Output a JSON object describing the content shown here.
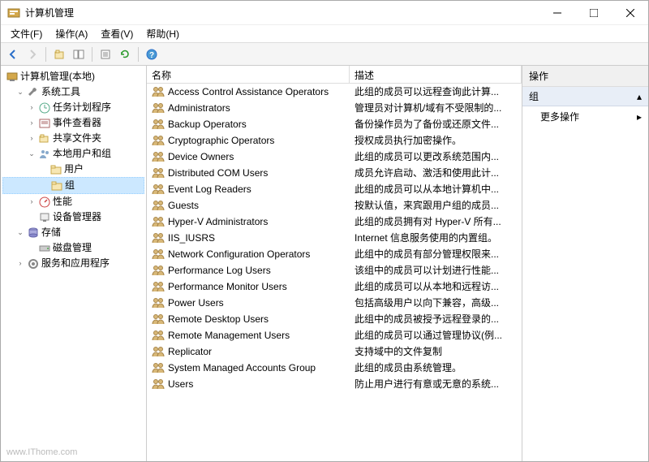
{
  "titlebar": {
    "title": "计算机管理"
  },
  "menubar": {
    "items": [
      "文件(F)",
      "操作(A)",
      "查看(V)",
      "帮助(H)"
    ]
  },
  "tree": {
    "root": "计算机管理(本地)",
    "nodes": [
      {
        "label": "系统工具",
        "depth": 1,
        "expanded": true,
        "icon": "wrench"
      },
      {
        "label": "任务计划程序",
        "depth": 2,
        "expanded": false,
        "hasChildren": true,
        "icon": "clock"
      },
      {
        "label": "事件查看器",
        "depth": 2,
        "expanded": false,
        "hasChildren": true,
        "icon": "event"
      },
      {
        "label": "共享文件夹",
        "depth": 2,
        "expanded": false,
        "hasChildren": true,
        "icon": "share"
      },
      {
        "label": "本地用户和组",
        "depth": 2,
        "expanded": true,
        "hasChildren": true,
        "icon": "users"
      },
      {
        "label": "用户",
        "depth": 3,
        "icon": "folder"
      },
      {
        "label": "组",
        "depth": 3,
        "icon": "folder",
        "selected": true
      },
      {
        "label": "性能",
        "depth": 2,
        "expanded": false,
        "hasChildren": true,
        "icon": "perf"
      },
      {
        "label": "设备管理器",
        "depth": 2,
        "icon": "device"
      },
      {
        "label": "存储",
        "depth": 1,
        "expanded": true,
        "icon": "storage"
      },
      {
        "label": "磁盘管理",
        "depth": 2,
        "icon": "disk"
      },
      {
        "label": "服务和应用程序",
        "depth": 1,
        "expanded": false,
        "hasChildren": true,
        "icon": "services"
      }
    ]
  },
  "list": {
    "columns": {
      "name": "名称",
      "desc": "描述"
    },
    "rows": [
      {
        "name": "Access Control Assistance Operators",
        "desc": "此组的成员可以远程查询此计算..."
      },
      {
        "name": "Administrators",
        "desc": "管理员对计算机/域有不受限制的..."
      },
      {
        "name": "Backup Operators",
        "desc": "备份操作员为了备份或还原文件..."
      },
      {
        "name": "Cryptographic Operators",
        "desc": "授权成员执行加密操作。"
      },
      {
        "name": "Device Owners",
        "desc": "此组的成员可以更改系统范围内..."
      },
      {
        "name": "Distributed COM Users",
        "desc": "成员允许启动、激活和使用此计..."
      },
      {
        "name": "Event Log Readers",
        "desc": "此组的成员可以从本地计算机中..."
      },
      {
        "name": "Guests",
        "desc": "按默认值，来宾跟用户组的成员..."
      },
      {
        "name": "Hyper-V Administrators",
        "desc": "此组的成员拥有对 Hyper-V 所有..."
      },
      {
        "name": "IIS_IUSRS",
        "desc": "Internet 信息服务使用的内置组。"
      },
      {
        "name": "Network Configuration Operators",
        "desc": "此组中的成员有部分管理权限来..."
      },
      {
        "name": "Performance Log Users",
        "desc": "该组中的成员可以计划进行性能..."
      },
      {
        "name": "Performance Monitor Users",
        "desc": "此组的成员可以从本地和远程访..."
      },
      {
        "name": "Power Users",
        "desc": "包括高级用户以向下兼容，高级..."
      },
      {
        "name": "Remote Desktop Users",
        "desc": "此组中的成员被授予远程登录的..."
      },
      {
        "name": "Remote Management Users",
        "desc": "此组的成员可以通过管理协议(例..."
      },
      {
        "name": "Replicator",
        "desc": "支持域中的文件复制"
      },
      {
        "name": "System Managed Accounts Group",
        "desc": "此组的成员由系统管理。"
      },
      {
        "name": "Users",
        "desc": "防止用户进行有意或无意的系统..."
      }
    ]
  },
  "actions": {
    "header": "操作",
    "group": "组",
    "more": "更多操作"
  },
  "watermark": "www.IThome.com"
}
